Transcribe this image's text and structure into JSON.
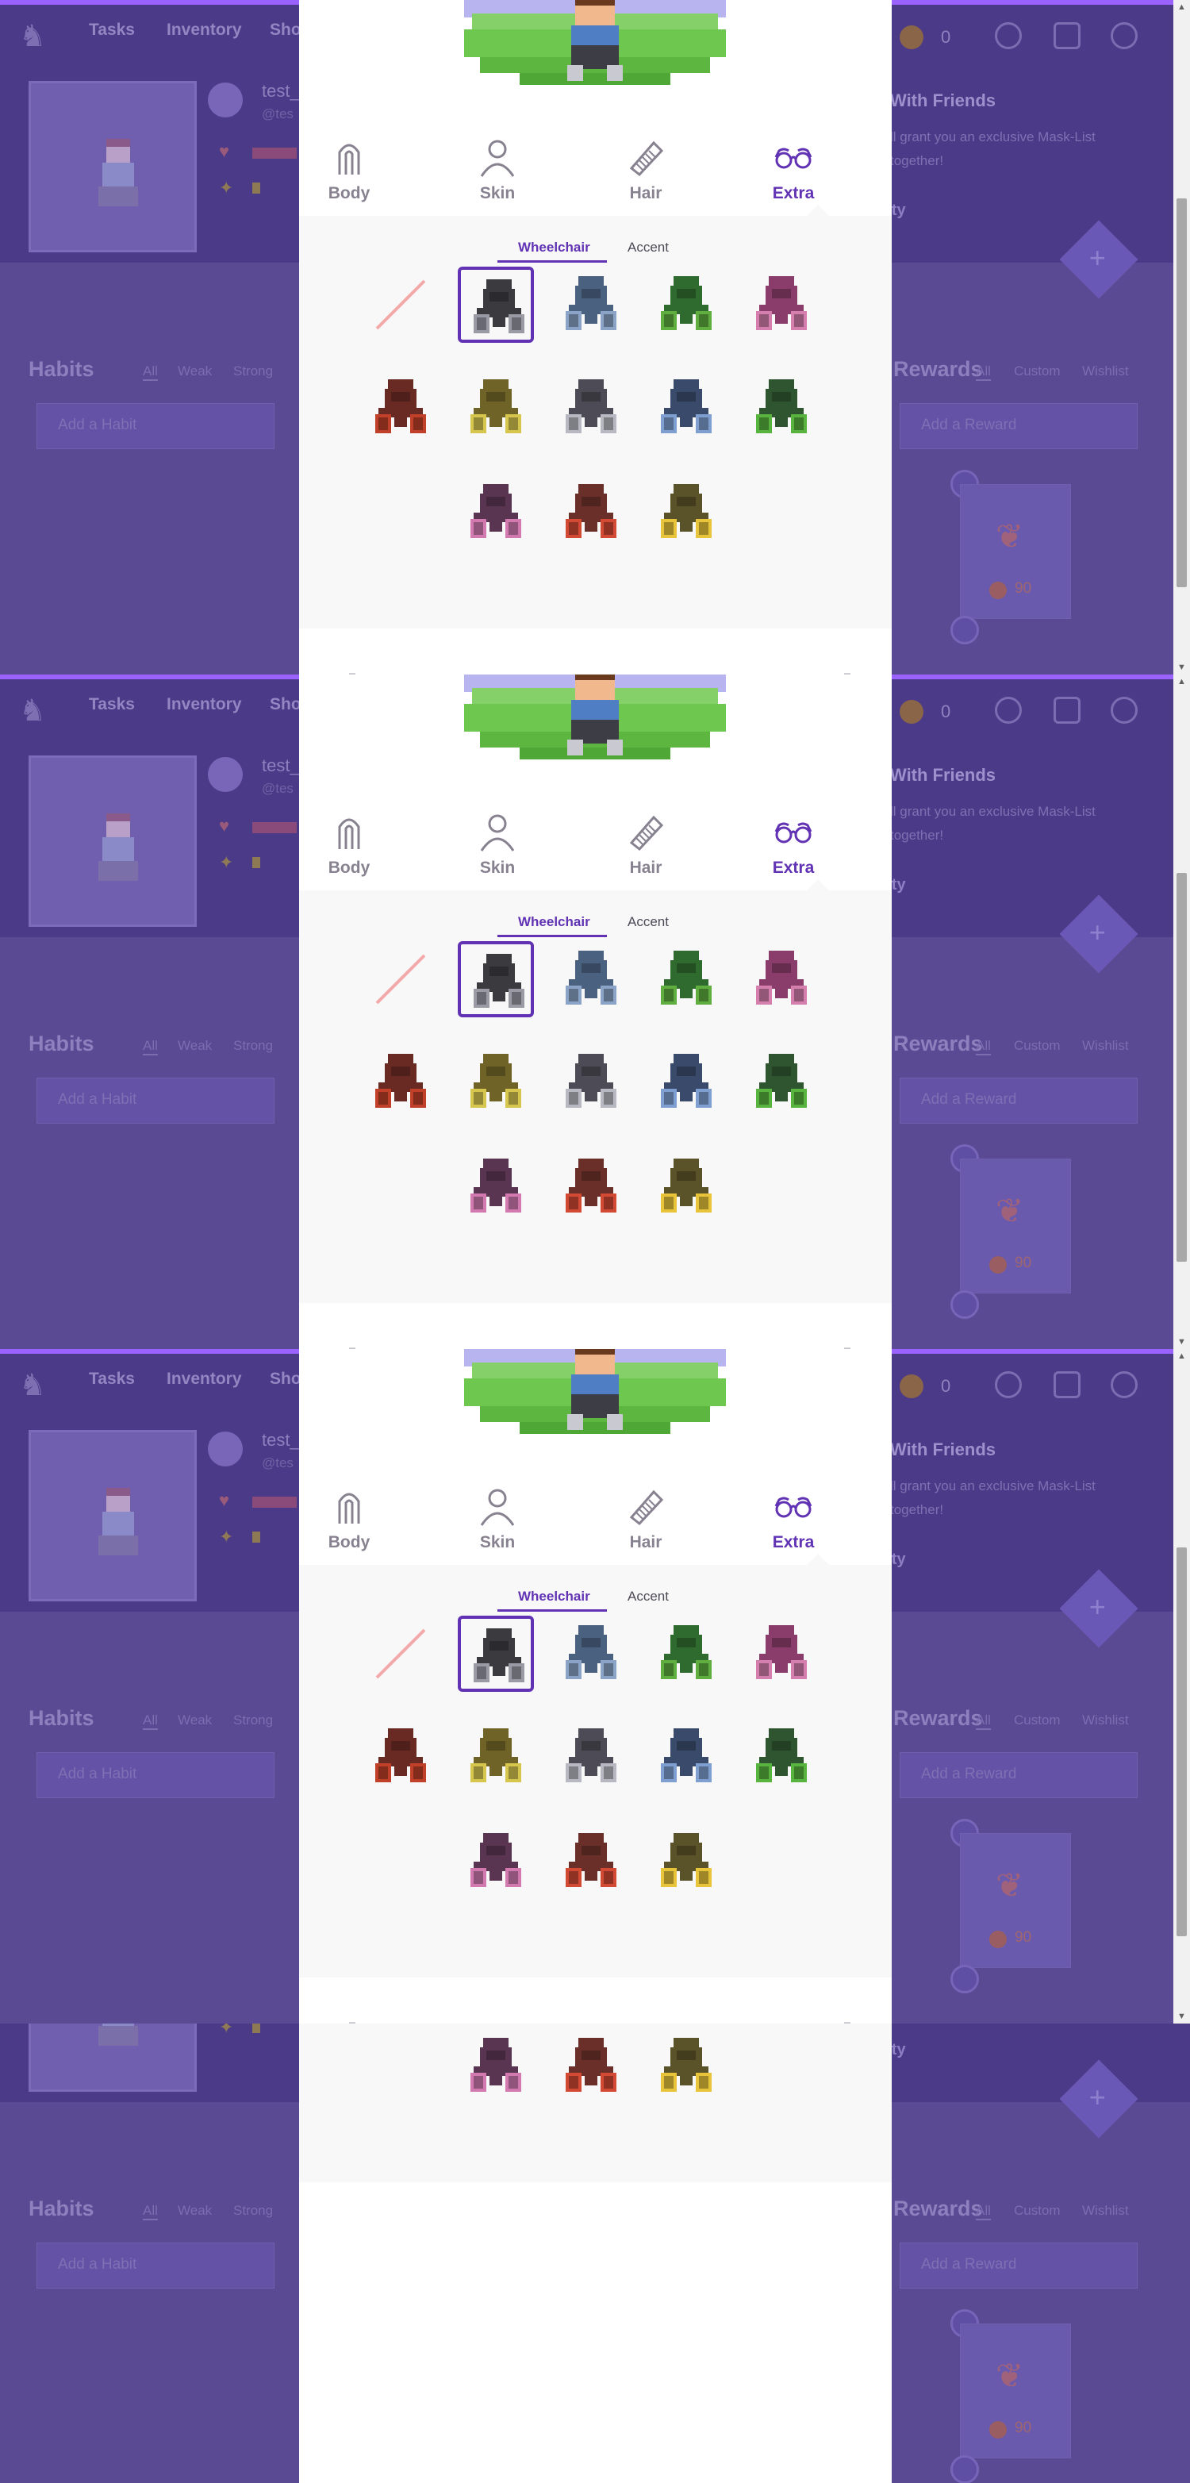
{
  "nav": {
    "items": [
      "Tasks",
      "Inventory",
      "Sho"
    ],
    "gold_value": "0"
  },
  "user": {
    "name": "test_",
    "handle": "@tes"
  },
  "promo": {
    "title": "With Friends",
    "text": "ll grant you an exclusive Mask-List together!",
    "button": "rty"
  },
  "habits": {
    "title": "Habits",
    "filters": [
      "All",
      "Weak",
      "Strong"
    ],
    "add_placeholder": "Add a Habit"
  },
  "rewards": {
    "title": "Rewards",
    "filters": [
      "All",
      "Custom",
      "Wishlist"
    ],
    "add_placeholder": "Add a Reward",
    "card_price": "90"
  },
  "customize": {
    "categories": [
      {
        "label": "Body",
        "icon": "body-icon"
      },
      {
        "label": "Skin",
        "icon": "skin-icon"
      },
      {
        "label": "Hair",
        "icon": "comb-icon"
      },
      {
        "label": "Extra",
        "icon": "glasses-icon",
        "active": true
      }
    ],
    "tabs": [
      {
        "label": "Wheelchair",
        "active": true
      },
      {
        "label": "Accent",
        "active": false
      }
    ],
    "wheelchair_options": [
      {
        "color": "none",
        "selected": false
      },
      {
        "color": "#3a3a3f",
        "accent": "#9a9aa5",
        "selected": true
      },
      {
        "color": "#4a6180",
        "accent": "#8aa3c6",
        "selected": false
      },
      {
        "color": "#2f6a2f",
        "accent": "#5fae3f",
        "selected": false
      },
      {
        "color": "#8a3d6a",
        "accent": "#d57fae",
        "selected": false
      },
      {
        "color": "#6a2a24",
        "accent": "#c0402a",
        "selected": false
      },
      {
        "color": "#6f6328",
        "accent": "#d6c64e",
        "selected": false
      },
      {
        "color": "#4d4b55",
        "accent": "#b8b8c2",
        "selected": false
      },
      {
        "color": "#3a4a6a",
        "accent": "#7f9fd0",
        "selected": false
      },
      {
        "color": "#2f5530",
        "accent": "#58b43e",
        "selected": false
      },
      {
        "color": "#5a3552",
        "accent": "#d27ab0",
        "selected": false
      },
      {
        "color": "#6a2f28",
        "accent": "#d24a34",
        "selected": false
      },
      {
        "color": "#5a5228",
        "accent": "#e8c43a",
        "selected": false
      }
    ]
  },
  "colors": {
    "accent": "#6133b4",
    "overlay": "#5a4a93",
    "highlight_strip": "#9a62ff"
  }
}
